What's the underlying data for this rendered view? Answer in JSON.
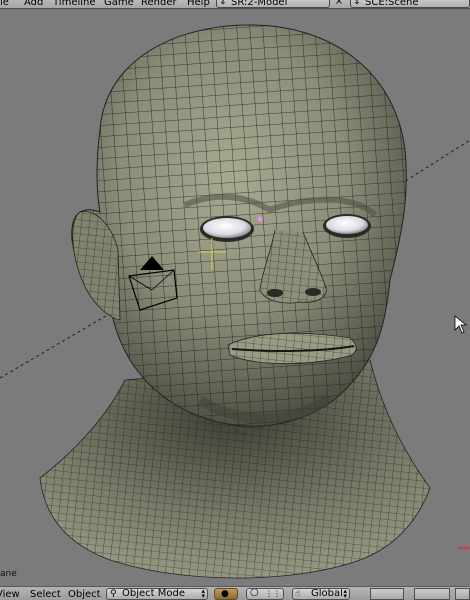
{
  "top_menu": {
    "items": [
      "le",
      "Add",
      "Timeline",
      "Game",
      "Render",
      "Help"
    ],
    "screen_label": "SR:2-Model",
    "scene_label": "SCE:Scene",
    "close_glyph": "×"
  },
  "viewport": {
    "object_name": "ane",
    "background_color": "#7b7b7b",
    "mesh_color": "#8d8f7b",
    "wire_color": "#1d1e16"
  },
  "bottom_menu": {
    "view_label": "View",
    "select_label": "Select",
    "object_label": "Object",
    "mode_value": "Object Mode",
    "orientation_value": "Global"
  }
}
